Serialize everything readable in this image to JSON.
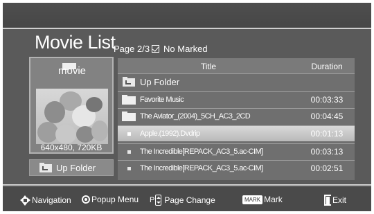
{
  "header": {
    "title": "Movie List",
    "page_info": "Page 2/3",
    "marked_status": "No Marked"
  },
  "preview": {
    "folder_name": "movie",
    "resolution": "640x480, 720KB",
    "up_folder_label": "Up Folder"
  },
  "table": {
    "col_title": "Title",
    "col_duration": "Duration",
    "rows": [
      {
        "type": "up-folder",
        "title": "Up Folder",
        "duration": ""
      },
      {
        "type": "folder",
        "title": "Favorite Music",
        "duration": "00:03:33"
      },
      {
        "type": "folder",
        "title": "The Aviator_(2004)_5CH_AC3_2CD",
        "duration": "00:04:45"
      },
      {
        "type": "file",
        "title": "Apple.(1992).Dvdrip",
        "duration": "00:01:13",
        "selected": true
      },
      {
        "type": "file",
        "title": "The Incredible[REPACK_AC3_5.ac-CIM]",
        "duration": "00:03:13"
      },
      {
        "type": "file",
        "title": "The Incredible[REPACK_AC3_5.ac-CIM]",
        "duration": "00:02:51"
      }
    ]
  },
  "footer": {
    "navigation": "Navigation",
    "popup_menu": "Popup Menu",
    "p_label": "P",
    "page_change": "Page Change",
    "mark_key": "MARK",
    "mark": "Mark",
    "exit": "Exit"
  },
  "icons": {
    "folder": "folder-icon",
    "up_folder": "up-folder-icon",
    "file": "file-dot-icon",
    "navigation": "navigation-arrows-icon",
    "popup": "popup-button-icon",
    "page": "page-rocker-icon",
    "exit": "exit-icon"
  },
  "colors": {
    "background": "#5a5a5a",
    "selected_row": "#cfcfcf",
    "panel": "#828282"
  }
}
